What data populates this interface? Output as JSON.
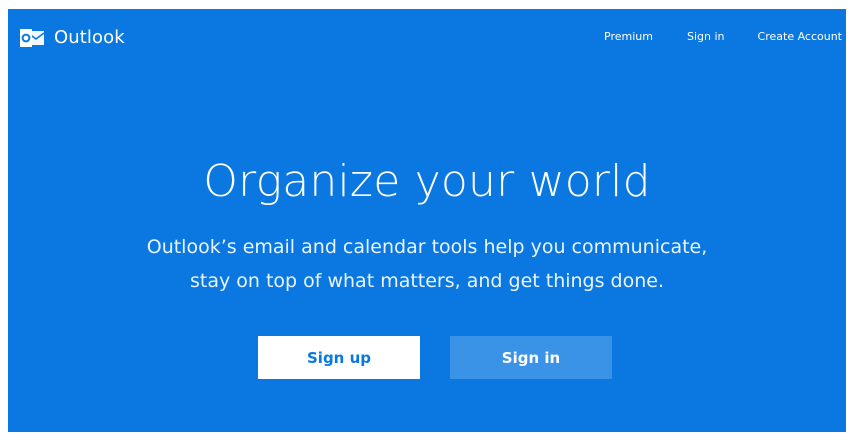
{
  "header": {
    "brand_name": "Outlook",
    "logo_icon": "outlook-logo-icon",
    "nav": {
      "premium": "Premium",
      "sign_in": "Sign in",
      "create_account": "Create Account"
    }
  },
  "hero": {
    "title": "Organize your world",
    "subtitle_line1": "Outlook’s email and calendar tools help you communicate,",
    "subtitle_line2": "stay on top of what matters, and get things done.",
    "signup_label": "Sign up",
    "signin_label": "Sign in"
  },
  "colors": {
    "background": "#0a78e0",
    "secondary_button": "#3a93e6",
    "primary_button": "#ffffff"
  }
}
